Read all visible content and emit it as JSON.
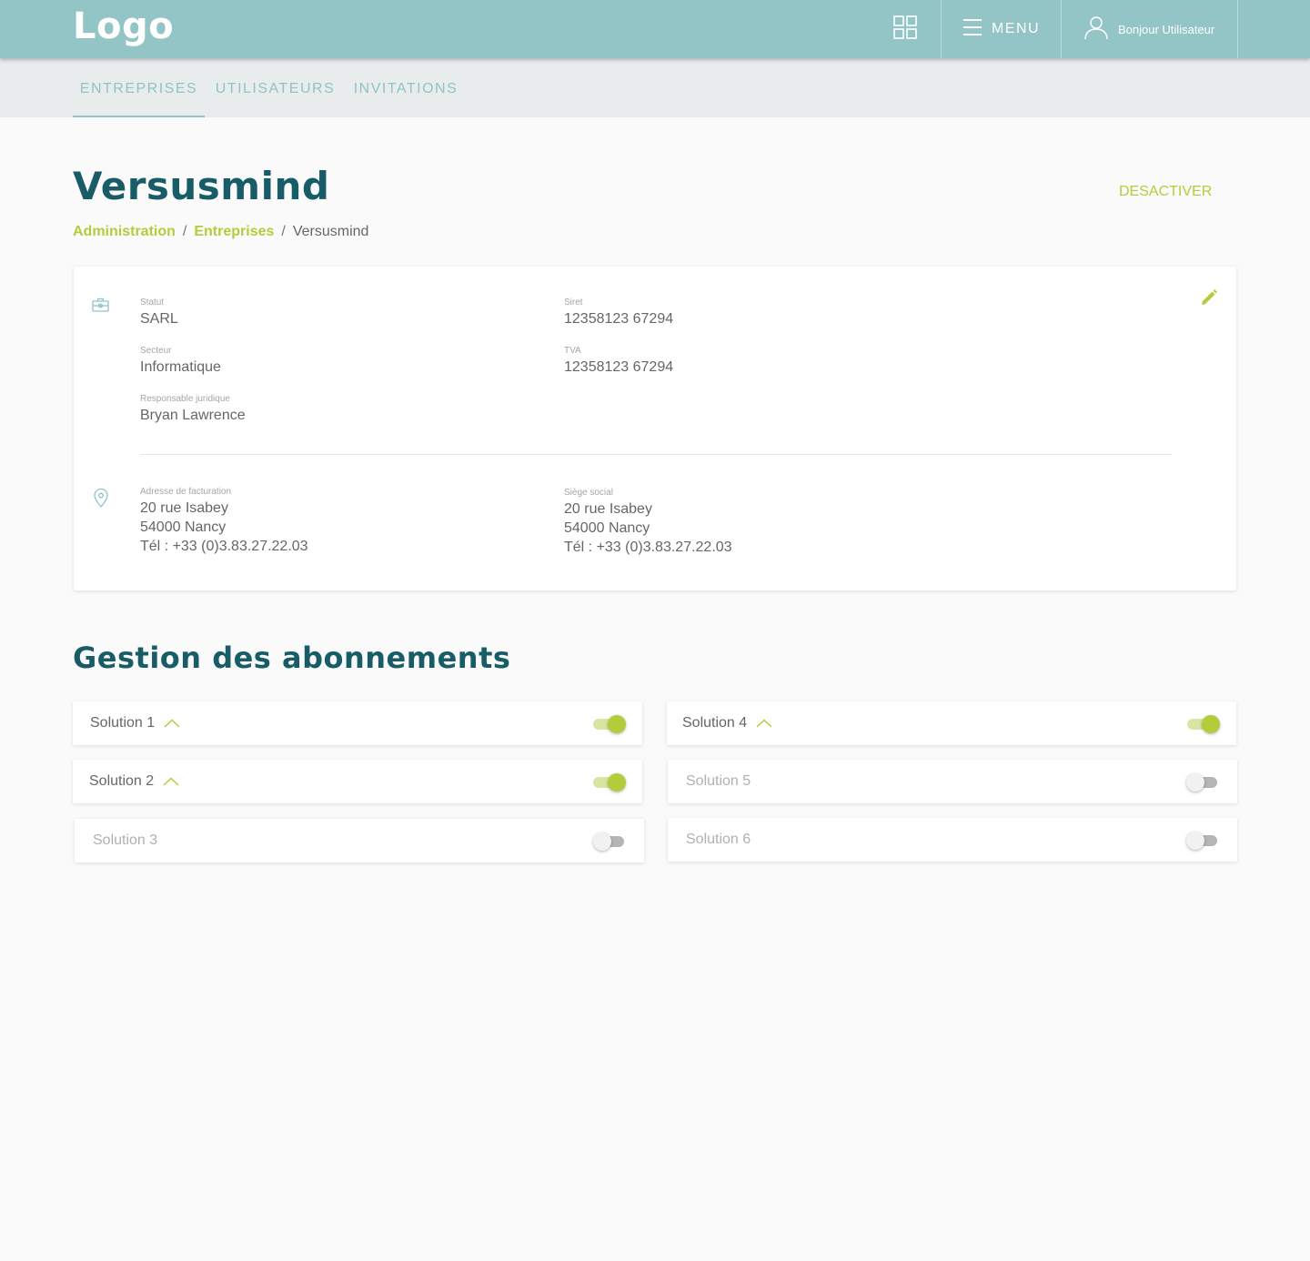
{
  "header": {
    "logo": "Logo",
    "apps_icon": "grid-icon",
    "menu_label": "MENU",
    "user_label": "Bonjour Utilisateur"
  },
  "tabs": [
    {
      "label": "ENTREPRISES",
      "active": true
    },
    {
      "label": "UTILISATEURS",
      "active": false
    },
    {
      "label": "INVITATIONS",
      "active": false
    }
  ],
  "page": {
    "title": "Versusmind",
    "deactivate_label": "DESACTIVER"
  },
  "breadcrumb": {
    "items": [
      "Administration",
      "Entreprises",
      "Versusmind"
    ],
    "separator": "/"
  },
  "company": {
    "statut": {
      "label": "Statut",
      "value": "SARL"
    },
    "secteur": {
      "label": "Secteur",
      "value": "Informatique"
    },
    "responsable": {
      "label": "Responsable juridique",
      "value": "Bryan Lawrence"
    },
    "siret": {
      "label": "Siret",
      "value": "12358123 67294"
    },
    "tva": {
      "label": "TVA",
      "value": "12358123 67294"
    },
    "billing": {
      "label": "Adresse de facturation",
      "lines": [
        "20 rue Isabey",
        "54000 Nancy",
        "Tél : +33 (0)3.83.27.22.03"
      ]
    },
    "hq": {
      "label": "Siège social",
      "lines": [
        "20 rue Isabey",
        "54000 Nancy",
        "Tél : +33 (0)3.83.27.22.03"
      ]
    }
  },
  "subscriptions": {
    "title": "Gestion des abonnements",
    "items": [
      {
        "name": "Solution 1",
        "enabled": true
      },
      {
        "name": "Solution 2",
        "enabled": true
      },
      {
        "name": "Solution 3",
        "enabled": false
      },
      {
        "name": "Solution 4",
        "enabled": true
      },
      {
        "name": "Solution 5",
        "enabled": false
      },
      {
        "name": "Solution 6",
        "enabled": false
      }
    ]
  },
  "colors": {
    "header_bg": "#93c5c6",
    "title": "#185c67",
    "accent": "#b3cd3a",
    "tab_text": "#8fc3c6"
  }
}
